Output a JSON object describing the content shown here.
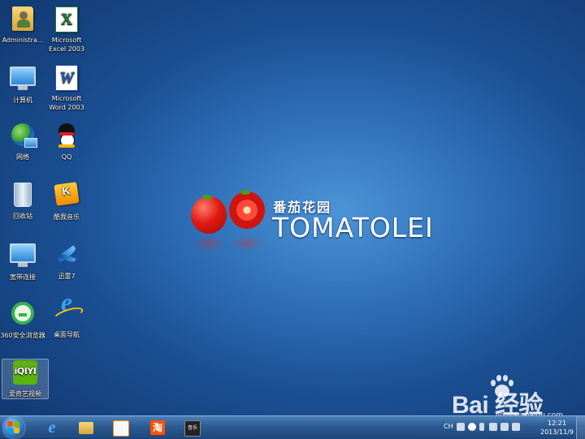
{
  "desktop": {
    "icons": [
      {
        "label": "Administra...",
        "icon": "user-folder-icon"
      },
      {
        "label": "Microsoft Excel 2003",
        "icon": "excel-icon"
      },
      {
        "label": "计算机",
        "icon": "computer-icon"
      },
      {
        "label": "Microsoft Word 2003",
        "icon": "word-icon"
      },
      {
        "label": "网络",
        "icon": "network-icon"
      },
      {
        "label": "QQ",
        "icon": "qq-icon"
      },
      {
        "label": "回收站",
        "icon": "recycle-bin-icon"
      },
      {
        "label": "酷我音乐",
        "icon": "kuwo-music-icon"
      },
      {
        "label": "宽带连接",
        "icon": "broadband-icon"
      },
      {
        "label": "迅雷7",
        "icon": "xunlei-icon"
      },
      {
        "label": "360安全浏览器",
        "icon": "360-browser-icon"
      },
      {
        "label": "桌面导航",
        "icon": "ie-icon"
      },
      {
        "label": "爱奇艺视频",
        "icon": "iqiyi-icon"
      }
    ]
  },
  "wallpaper": {
    "logo_cn": "番茄花园",
    "logo_en": "TOMATOLEI"
  },
  "watermark": {
    "main": "Bai  经验",
    "sub": "jingyan.baidu.com"
  },
  "taskbar": {
    "pinned": [
      "ie-icon",
      "explorer-folder-icon",
      "media-player-icon",
      "taobao-icon",
      "music-app-icon"
    ],
    "taobao_text": "淘",
    "music_text": "音乐"
  },
  "tray": {
    "lang": "CH",
    "time": "12:21",
    "date": "2013/11/9"
  },
  "colors": {
    "desktop_center": "#4c94d6",
    "desktop_edge": "#123b74",
    "taskbar": "#2c5b93"
  }
}
